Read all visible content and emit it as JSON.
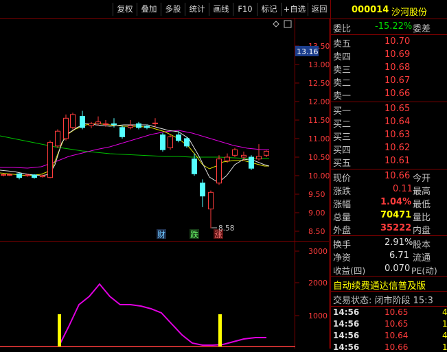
{
  "toolbar": {
    "buttons": [
      "复权",
      "叠加",
      "多股",
      "统计",
      "画线",
      "F10",
      "标记",
      "+自选",
      "返回"
    ]
  },
  "stock": {
    "code": "000014",
    "name": "沙河股份"
  },
  "price_axis": {
    "ticks": [
      "13.50",
      "13.00",
      "12.50",
      "12.00",
      "11.50",
      "11.00",
      "10.50",
      "10.00",
      "9.50",
      "9.00",
      "8.50"
    ],
    "cursor_price": "13.16"
  },
  "volume_axis": {
    "ticks": [
      "3000",
      "2000",
      "1000"
    ]
  },
  "markers": {
    "cai": "财",
    "die": "跌",
    "zhang": "涨",
    "low_label": "8.58"
  },
  "order_book": {
    "weibi_label": "委比",
    "weibi_value": "-15.22%",
    "weicha_label": "委差",
    "asks": [
      {
        "label": "卖五",
        "price": "10.70"
      },
      {
        "label": "卖四",
        "price": "10.69"
      },
      {
        "label": "卖三",
        "price": "10.68"
      },
      {
        "label": "卖二",
        "price": "10.67"
      },
      {
        "label": "卖一",
        "price": "10.66"
      }
    ],
    "bids": [
      {
        "label": "买一",
        "price": "10.65"
      },
      {
        "label": "买二",
        "price": "10.64"
      },
      {
        "label": "买三",
        "price": "10.63"
      },
      {
        "label": "买四",
        "price": "10.62"
      },
      {
        "label": "买五",
        "price": "10.61"
      }
    ]
  },
  "quote": {
    "rows": [
      {
        "label": "现价",
        "value": "10.66",
        "label2": "今开",
        "color": "red"
      },
      {
        "label": "涨跌",
        "value": "0.11",
        "label2": "最高",
        "color": "red"
      },
      {
        "label": "涨幅",
        "value": "1.04%",
        "label2": "最低",
        "color": "red"
      },
      {
        "label": "总量",
        "value": "70471",
        "label2": "量比",
        "color": "yellow"
      },
      {
        "label": "外盘",
        "value": "35222",
        "label2": "内盘",
        "color": "red"
      }
    ]
  },
  "fundamentals": {
    "rows": [
      {
        "label": "换手",
        "value": "2.91%",
        "label2": "股本"
      },
      {
        "label": "净资",
        "value": "6.71",
        "label2": "流通"
      },
      {
        "label": "收益(四)",
        "value": "0.070",
        "label2": "PE(动)"
      }
    ]
  },
  "banner": "自动续费通达信普及版",
  "trade_status": "交易状态: 闭市阶段 15:3",
  "ticks": [
    {
      "time": "14:56",
      "price": "10.65",
      "vol": "4"
    },
    {
      "time": "14:56",
      "price": "10.65",
      "vol": "1"
    },
    {
      "time": "14:56",
      "price": "10.64",
      "vol": "4"
    },
    {
      "time": "14:56",
      "price": "10.66",
      "vol": "1"
    }
  ]
}
